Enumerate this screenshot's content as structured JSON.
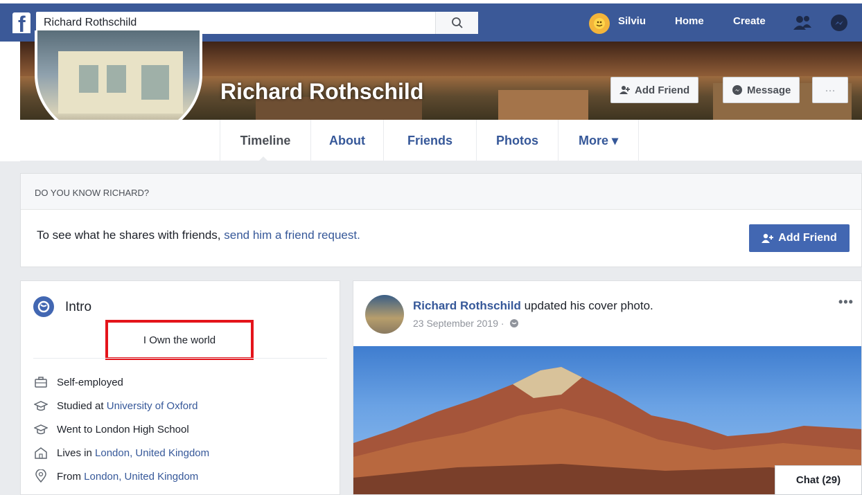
{
  "header": {
    "logo": "f",
    "search_value": "Richard Rothschild",
    "user_name": "Silviu",
    "nav_home": "Home",
    "nav_create": "Create"
  },
  "profile": {
    "name": "Richard Rothschild",
    "add_friend_label": "Add Friend",
    "message_label": "Message",
    "more_dots": "···"
  },
  "tabs": [
    {
      "label": "Timeline",
      "active": true
    },
    {
      "label": "About"
    },
    {
      "label": "Friends"
    },
    {
      "label": "Photos"
    },
    {
      "label": "More ▾"
    }
  ],
  "know_box": {
    "heading": "DO YOU KNOW RICHARD?",
    "text": "To see what he shares with friends,",
    "link": "send him a friend request.",
    "button": "Add Friend"
  },
  "intro": {
    "title": "Intro",
    "bio": "I Own the world",
    "rows": [
      {
        "icon": "work-icon",
        "text": "Self-employed",
        "link": ""
      },
      {
        "icon": "education-icon",
        "text": "Studied at ",
        "link": "University of Oxford"
      },
      {
        "icon": "school-icon",
        "text": "Went to London High School",
        "link": ""
      },
      {
        "icon": "home-icon",
        "text": "Lives in ",
        "link": "London, United Kingdom"
      },
      {
        "icon": "location-pin-icon",
        "text": "From ",
        "link": "London, United Kingdom"
      }
    ]
  },
  "post": {
    "author": "Richard Rothschild",
    "action": "updated his cover photo.",
    "date": "23 September 2019 ·",
    "more": "•••"
  },
  "chat": {
    "label": "Chat (29)"
  },
  "colors": {
    "brand": "#3b5998",
    "link": "#365899",
    "button": "#4267b2",
    "highlight": "#e4141b"
  }
}
